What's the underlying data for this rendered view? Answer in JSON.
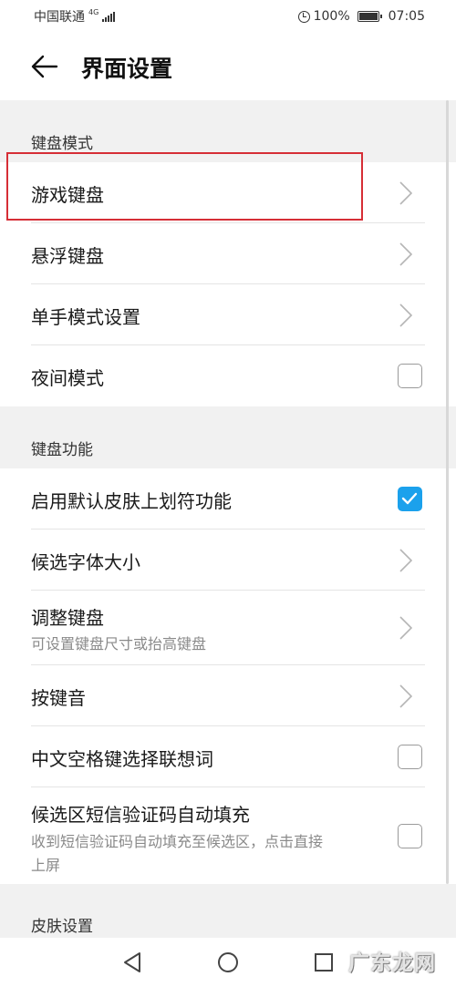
{
  "status_bar": {
    "carrier": "中国联通",
    "network": "4G",
    "battery": "100%",
    "time": "07:05"
  },
  "app_bar": {
    "title": "界面设置"
  },
  "sections": {
    "keyboard_mode": {
      "header": "键盘模式",
      "game_keyboard": "游戏键盘",
      "floating_keyboard": "悬浮键盘",
      "one_hand_mode": "单手模式设置",
      "night_mode": "夜间模式",
      "night_mode_checked": false
    },
    "keyboard_function": {
      "header": "键盘功能",
      "default_skin_swipe": "启用默认皮肤上划符功能",
      "default_skin_swipe_checked": true,
      "candidate_font_size": "候选字体大小",
      "adjust_keyboard": "调整键盘",
      "adjust_keyboard_sub": "可设置键盘尺寸或抬高键盘",
      "key_sound": "按键音",
      "space_select_association": "中文空格键选择联想词",
      "space_select_association_checked": false,
      "sms_code_autofill": "候选区短信验证码自动填充",
      "sms_code_autofill_sub_line1": "收到短信验证码自动填充至候选区，点击直接",
      "sms_code_autofill_sub_line2": "上屏",
      "sms_code_autofill_checked": false
    },
    "skin_settings": {
      "header": "皮肤设置"
    }
  },
  "watermark": "广东龙网",
  "colors": {
    "accent": "#1ba1ec",
    "highlight": "#d62e36",
    "background": "#f1f1f1"
  }
}
